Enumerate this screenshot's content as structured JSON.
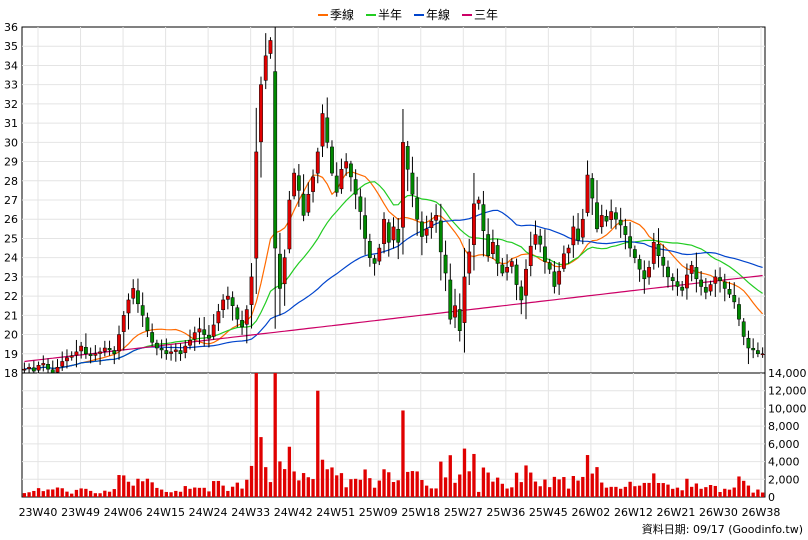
{
  "chart_data": {
    "type": "candlestick",
    "legend": [
      {
        "name": "季線",
        "color": "#ff6a00"
      },
      {
        "name": "半年",
        "color": "#22cc22"
      },
      {
        "name": "年線",
        "color": "#0044cc"
      },
      {
        "name": "三年",
        "color": "#cc0066"
      }
    ],
    "price_axis": {
      "min": 18,
      "max": 36,
      "ticks": [
        18,
        19,
        20,
        21,
        22,
        23,
        24,
        25,
        26,
        27,
        28,
        29,
        30,
        31,
        32,
        33,
        34,
        35,
        36
      ]
    },
    "volume_axis": {
      "min": 0,
      "max": 14000,
      "ticks": [
        0,
        2000,
        4000,
        6000,
        8000,
        10000,
        12000,
        14000
      ],
      "tick_labels": [
        "0",
        "2,000",
        "4,000",
        "6,000",
        "8,000",
        "10,000",
        "12,000",
        "14,000"
      ]
    },
    "x_labels": [
      "23W40",
      "23W49",
      "24W06",
      "24W15",
      "24W24",
      "24W33",
      "24W42",
      "24W51",
      "25W09",
      "25W18",
      "25W27",
      "25W36",
      "25W45",
      "26W02",
      "26W12",
      "26W21",
      "26W30",
      "26W38"
    ],
    "weeks_total": 157,
    "closes": [
      18.2,
      18.3,
      18.1,
      18.4,
      18.5,
      18.2,
      18.0,
      18.3,
      18.6,
      18.8,
      18.9,
      19.1,
      19.4,
      19.0,
      18.9,
      19.0,
      19.1,
      19.3,
      19.2,
      19.0,
      20.0,
      21.0,
      21.8,
      22.4,
      21.6,
      21.0,
      20.2,
      19.6,
      19.3,
      19.2,
      19.0,
      19.1,
      19.2,
      19.0,
      19.4,
      19.7,
      20.1,
      20.3,
      20.0,
      19.8,
      20.5,
      21.2,
      21.8,
      22.0,
      21.5,
      20.8,
      20.4,
      21.3,
      23.0,
      29.5,
      33.0,
      34.5,
      35.3,
      24.5,
      22.4,
      24.0,
      27.0,
      28.4,
      27.5,
      26.2,
      27.3,
      28.2,
      29.5,
      31.5,
      30.0,
      28.4,
      27.4,
      28.6,
      29.0,
      28.2,
      27.3,
      26.4,
      25.0,
      24.0,
      23.7,
      24.5,
      26.0,
      24.8,
      25.6,
      24.8,
      30.0,
      28.6,
      27.3,
      26.0,
      25.1,
      25.5,
      25.9,
      26.2,
      24.3,
      23.2,
      20.8,
      21.5,
      20.2,
      23.0,
      24.3,
      26.8,
      27.0,
      25.4,
      24.1,
      24.8,
      23.7,
      23.2,
      23.5,
      23.8,
      22.6,
      21.8,
      23.4,
      24.6,
      25.2,
      24.7,
      23.8,
      23.4,
      22.5,
      23.3,
      24.2,
      24.5,
      25.6,
      24.9,
      26.0,
      28.3,
      27.1,
      25.5,
      26.2,
      25.9,
      26.4,
      26.0,
      25.7,
      25.2,
      24.5,
      24.0,
      23.4,
      22.9,
      23.5,
      24.8,
      24.1,
      23.6,
      23.0,
      22.8,
      22.5,
      22.3,
      23.1,
      23.6,
      22.9,
      22.5,
      22.2,
      22.6,
      23.0,
      22.8,
      22.4,
      22.1,
      21.7,
      20.8,
      19.9,
      19.3,
      19.2,
      19.0,
      19.0
    ]
  },
  "credit": "資料日期: 09/17  (Goodinfo.tw)"
}
